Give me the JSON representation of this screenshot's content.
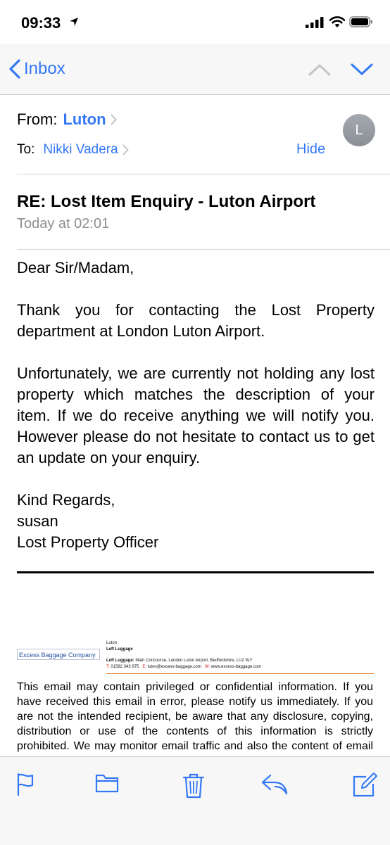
{
  "status_bar": {
    "time": "09:33"
  },
  "nav": {
    "back_label": "Inbox"
  },
  "header": {
    "from_label": "From:",
    "from_name": "Luton",
    "to_label": "To:",
    "to_name": "Nikki Vadera",
    "hide_label": "Hide",
    "avatar_initial": "L"
  },
  "message": {
    "subject": "RE: Lost Item Enquiry - Luton Airport",
    "date": "Today at 02:01",
    "greeting": "Dear Sir/Madam,",
    "para1": "Thank you for contacting the Lost Property department at London Luton Airport.",
    "para2": "Unfortunately, we are currently not holding any lost property which matches the description of your item. If we do receive anything we will notify you. However please do not hesitate to contact us to get an update on your enquiry.",
    "closing": "Kind Regards,",
    "sender": "susan",
    "role": "Lost Property Officer"
  },
  "signature": {
    "logo_text": "Excess Baggage Company",
    "line1": "Luton",
    "line2": "Left Luggage",
    "address_label": "Left Luggage:",
    "address": "Main Concourse, London Luton Airport, Bedfordshire, LU2 9LY",
    "tel_label": "T:",
    "tel": "01582 343 975",
    "email_label": "E:",
    "email": "luton@excess-baggage.com",
    "web_label": "W:",
    "web": "www.excess-baggage.com"
  },
  "disclaimer": "This email may contain privileged or confidential information. If you have received this email in error, please notify us immediately. If you are not the intended recipient, be aware that any disclosure, copying, distribution or use of the contents of this information is strictly prohibited. We may monitor email traffic and also the content of email for the purposes of security and staff training. This includes scanning",
  "toolbar": {
    "icons": [
      "flag-icon",
      "folder-icon",
      "trash-icon",
      "reply-icon",
      "compose-icon"
    ]
  },
  "colors": {
    "accent": "#3478f6",
    "bar_bg": "#f7f7f7",
    "secondary_text": "#8e8e93"
  }
}
